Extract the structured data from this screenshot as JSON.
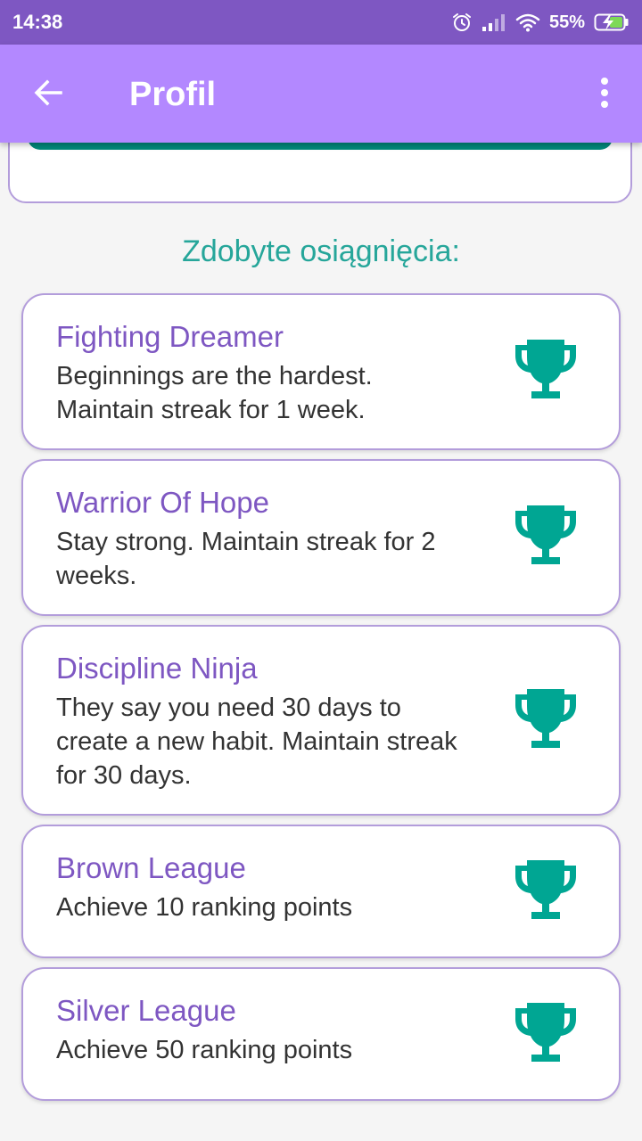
{
  "status_bar": {
    "time": "14:38",
    "battery": "55%",
    "icons": [
      "alarm-icon",
      "signal-icon",
      "wifi-icon",
      "battery-charging-icon"
    ],
    "color": "#7e57c2"
  },
  "app_bar": {
    "title": "Profil",
    "back_icon": "arrow-back-icon",
    "menu_icon": "more-vertical-icon",
    "color": "#b388ff"
  },
  "achievements": {
    "heading": "Zdobyte osiągnięcia:",
    "accent_color": "#26a69a",
    "title_color": "#7e57c2",
    "items": [
      {
        "title": "Fighting Dreamer",
        "description": "Beginnings are the hardest. Maintain streak for 1 week.",
        "icon": "trophy-icon"
      },
      {
        "title": "Warrior Of Hope",
        "description": "Stay strong. Maintain streak for 2 weeks.",
        "icon": "trophy-icon"
      },
      {
        "title": "Discipline Ninja",
        "description": "They say you need 30 days to create a new habit. Maintain streak for 30 days.",
        "icon": "trophy-icon"
      },
      {
        "title": "Brown League",
        "description": "Achieve 10 ranking points",
        "icon": "trophy-icon"
      },
      {
        "title": "Silver League",
        "description": "Achieve 50 ranking points",
        "icon": "trophy-icon"
      }
    ]
  }
}
